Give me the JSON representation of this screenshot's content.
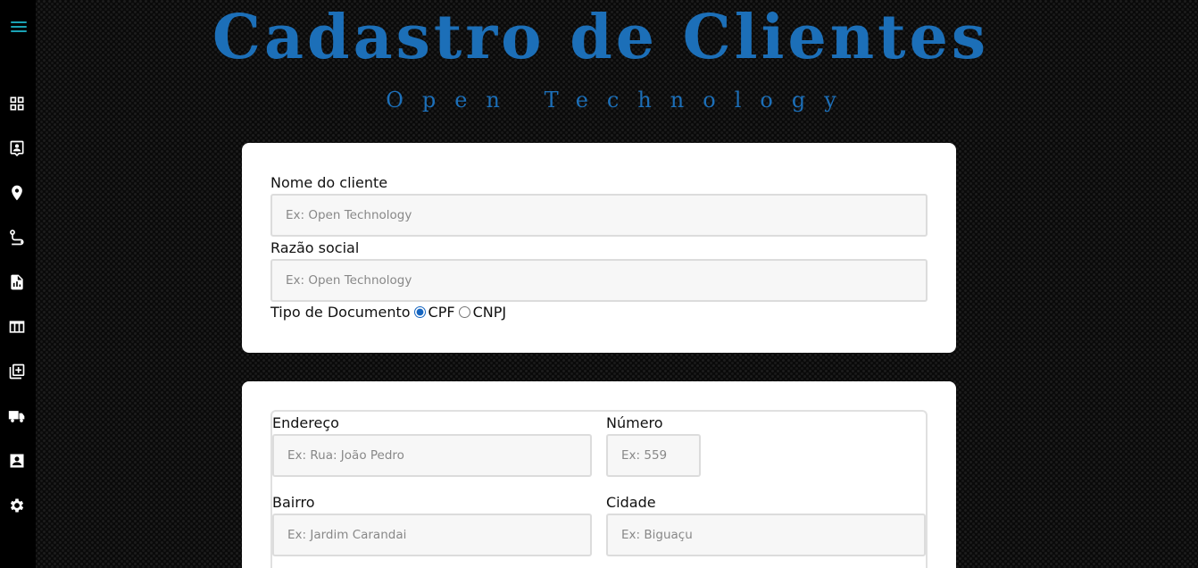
{
  "header": {
    "title": "Cadastro de Clientes",
    "subtitle": "Open Technology"
  },
  "sidebar": {
    "items": [
      {
        "icon": "dashboard-icon"
      },
      {
        "icon": "contact-badge-icon"
      },
      {
        "icon": "map-pin-icon"
      },
      {
        "icon": "route-icon"
      },
      {
        "icon": "report-file-icon"
      },
      {
        "icon": "table-columns-icon"
      },
      {
        "icon": "library-add-icon"
      },
      {
        "icon": "truck-icon"
      },
      {
        "icon": "account-box-icon"
      },
      {
        "icon": "gear-icon"
      }
    ]
  },
  "client_form": {
    "name_label": "Nome do cliente",
    "name_placeholder": "Ex: Open Technology",
    "company_label": "Razão social",
    "company_placeholder": "Ex: Open Technology",
    "doc_type_label": "Tipo de Documento",
    "doc_options": [
      "CPF",
      "CNPJ"
    ],
    "doc_selected": "CPF"
  },
  "address_form": {
    "street_label": "Endereço",
    "street_placeholder": "Ex: Rua: João Pedro",
    "number_label": "Número",
    "number_placeholder": "Ex: 559",
    "district_label": "Bairro",
    "district_placeholder": "Ex: Jardim Carandai",
    "city_label": "Cidade",
    "city_placeholder": "Ex: Biguaçu"
  },
  "colors": {
    "accent": "#1c6fb8",
    "menu_icon": "#1aa3b5",
    "background": "#0a0a0a",
    "card": "#ffffff"
  }
}
